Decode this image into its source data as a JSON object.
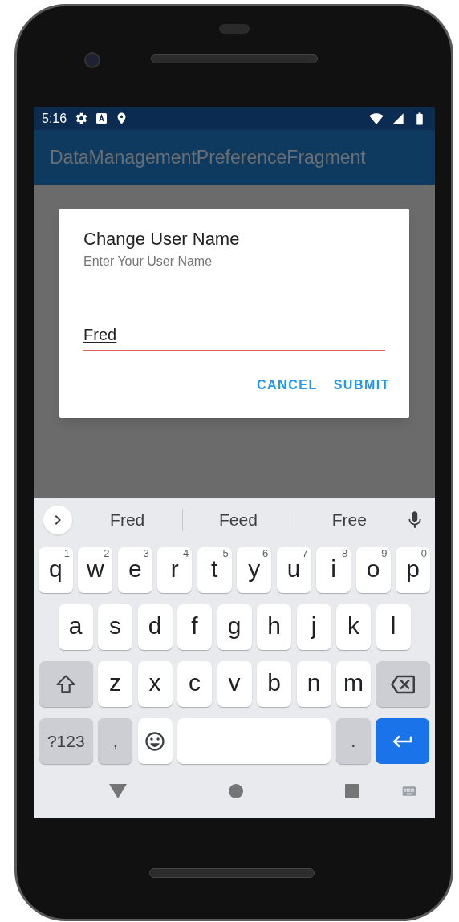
{
  "status_bar": {
    "time": "5:16"
  },
  "app_bar": {
    "title": "DataManagementPreferenceFragment"
  },
  "dialog": {
    "title": "Change User Name",
    "message": "Enter Your User Name",
    "field": {
      "value": "Fred"
    },
    "buttons": [
      "CANCEL",
      "SUBMIT"
    ]
  },
  "keyboard": {
    "suggestions": [
      "Fred",
      "Feed",
      "Free"
    ],
    "rows": [
      {
        "keys": [
          {
            "kind": "letter",
            "label": "q",
            "hint": "1"
          },
          {
            "kind": "letter",
            "label": "w",
            "hint": "2"
          },
          {
            "kind": "letter",
            "label": "e",
            "hint": "3"
          },
          {
            "kind": "letter",
            "label": "r",
            "hint": "4"
          },
          {
            "kind": "letter",
            "label": "t",
            "hint": "5"
          },
          {
            "kind": "letter",
            "label": "y",
            "hint": "6"
          },
          {
            "kind": "letter",
            "label": "u",
            "hint": "7"
          },
          {
            "kind": "letter",
            "label": "i",
            "hint": "8"
          },
          {
            "kind": "letter",
            "label": "o",
            "hint": "9"
          },
          {
            "kind": "letter",
            "label": "p",
            "hint": "0"
          }
        ]
      },
      {
        "keys": [
          {
            "kind": "letter",
            "label": "a"
          },
          {
            "kind": "letter",
            "label": "s"
          },
          {
            "kind": "letter",
            "label": "d"
          },
          {
            "kind": "letter",
            "label": "f"
          },
          {
            "kind": "letter",
            "label": "g"
          },
          {
            "kind": "letter",
            "label": "h"
          },
          {
            "kind": "letter",
            "label": "j"
          },
          {
            "kind": "letter",
            "label": "k"
          },
          {
            "kind": "letter",
            "label": "l"
          }
        ]
      },
      {
        "keys": [
          {
            "kind": "shift"
          },
          {
            "kind": "letter",
            "label": "z"
          },
          {
            "kind": "letter",
            "label": "x"
          },
          {
            "kind": "letter",
            "label": "c"
          },
          {
            "kind": "letter",
            "label": "v"
          },
          {
            "kind": "letter",
            "label": "b"
          },
          {
            "kind": "letter",
            "label": "n"
          },
          {
            "kind": "letter",
            "label": "m"
          },
          {
            "kind": "backspace"
          }
        ]
      },
      {
        "keys": [
          {
            "kind": "symbols",
            "label": "?123"
          },
          {
            "kind": "punct",
            "label": ","
          },
          {
            "kind": "emoji"
          },
          {
            "kind": "space"
          },
          {
            "kind": "punct",
            "label": "."
          },
          {
            "kind": "enter"
          }
        ]
      }
    ]
  }
}
